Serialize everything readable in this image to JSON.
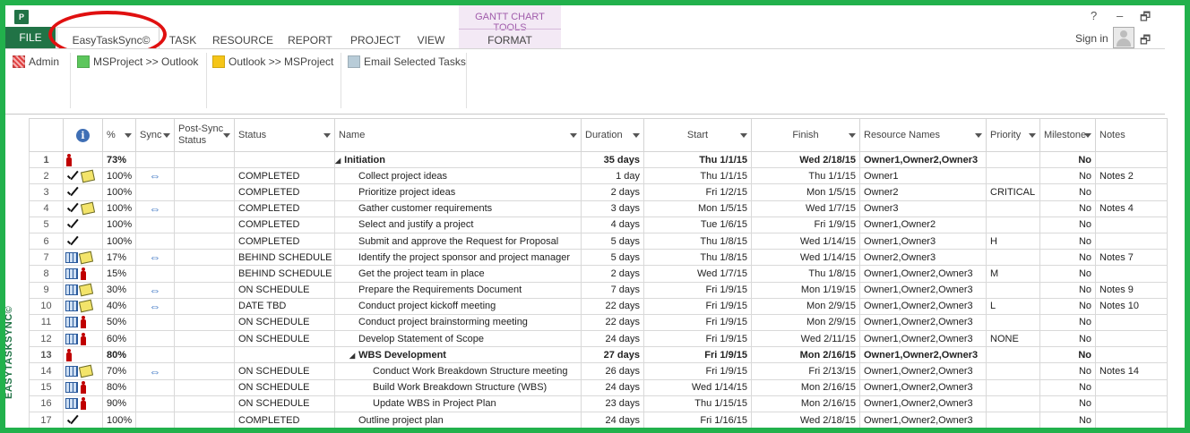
{
  "app": {
    "icon": "P",
    "icon_name": "ms-project-icon"
  },
  "tabs": {
    "file": "FILE",
    "easytasksync": "EasyTaskSync©",
    "task": "TASK",
    "resource": "RESOURCE",
    "report": "REPORT",
    "project": "PROJECT",
    "view": "VIEW",
    "context_group": "GANTT CHART TOOLS",
    "format": "FORMAT"
  },
  "window": {
    "help": "?",
    "minimize": "–",
    "restore": "🗗",
    "restore2": "🗗",
    "signin": "Sign in"
  },
  "ribbon": {
    "admin": "Admin",
    "ms_to_outlook": "MSProject >> Outlook",
    "outlook_to_ms": "Outlook >> MSProject",
    "email_tasks": "Email Selected Tasks"
  },
  "colors": {
    "file_tab": "#217346",
    "frame": "#22b14c",
    "highlight_ellipse": "#e01010",
    "context": "#a05cab",
    "admin": "#e04040",
    "ms_to_outlook": "#5cc65c",
    "outlook_to_ms": "#f5c518",
    "email": "#b8ccd8"
  },
  "side_label": "EASYTASKSYNC©",
  "columns": {
    "pct": "%",
    "sync": "Sync",
    "post_sync_status": "Post-Sync Status",
    "status": "Status",
    "name": "Name",
    "duration": "Duration",
    "start": "Start",
    "finish": "Finish",
    "resource_names": "Resource Names",
    "priority": "Priority",
    "milestone": "Milestone",
    "notes": "Notes"
  },
  "rows": [
    {
      "id": "1",
      "icons": [
        "person"
      ],
      "pct": "73%",
      "sync": false,
      "status": "",
      "name": "Initiation",
      "level": 0,
      "summary": true,
      "duration": "35 days",
      "start": "Thu 1/1/15",
      "finish": "Wed 2/18/15",
      "resources": "Owner1,Owner2,Owner3",
      "priority": "",
      "milestone": "No",
      "notes": ""
    },
    {
      "id": "2",
      "icons": [
        "check",
        "note"
      ],
      "pct": "100%",
      "sync": true,
      "status": "COMPLETED",
      "name": "Collect project ideas",
      "level": 1,
      "summary": false,
      "duration": "1 day",
      "start": "Thu 1/1/15",
      "finish": "Thu 1/1/15",
      "resources": "Owner1",
      "priority": "",
      "milestone": "No",
      "notes": "Notes 2"
    },
    {
      "id": "3",
      "icons": [
        "check"
      ],
      "pct": "100%",
      "sync": false,
      "status": "COMPLETED",
      "name": "Prioritize project ideas",
      "level": 1,
      "summary": false,
      "duration": "2 days",
      "start": "Fri 1/2/15",
      "finish": "Mon 1/5/15",
      "resources": "Owner2",
      "priority": "CRITICAL",
      "milestone": "No",
      "notes": ""
    },
    {
      "id": "4",
      "icons": [
        "check",
        "note"
      ],
      "pct": "100%",
      "sync": true,
      "status": "COMPLETED",
      "name": "Gather customer requirements",
      "level": 1,
      "summary": false,
      "duration": "3 days",
      "start": "Mon 1/5/15",
      "finish": "Wed 1/7/15",
      "resources": "Owner3",
      "priority": "",
      "milestone": "No",
      "notes": "Notes 4"
    },
    {
      "id": "5",
      "icons": [
        "check"
      ],
      "pct": "100%",
      "sync": false,
      "status": "COMPLETED",
      "name": "Select and justify a project",
      "level": 1,
      "summary": false,
      "duration": "4 days",
      "start": "Tue 1/6/15",
      "finish": "Fri 1/9/15",
      "resources": "Owner1,Owner2",
      "priority": "",
      "milestone": "No",
      "notes": ""
    },
    {
      "id": "6",
      "icons": [
        "check"
      ],
      "pct": "100%",
      "sync": false,
      "status": "COMPLETED",
      "name": "Submit and approve the Request for Proposal",
      "level": 1,
      "summary": false,
      "duration": "5 days",
      "start": "Thu 1/8/15",
      "finish": "Wed 1/14/15",
      "resources": "Owner1,Owner3",
      "priority": "H",
      "milestone": "No",
      "notes": ""
    },
    {
      "id": "7",
      "icons": [
        "table",
        "note"
      ],
      "pct": "17%",
      "sync": true,
      "status": "BEHIND SCHEDULE",
      "name": "Identify the project sponsor and project manager",
      "level": 1,
      "summary": false,
      "duration": "5 days",
      "start": "Thu 1/8/15",
      "finish": "Wed 1/14/15",
      "resources": "Owner2,Owner3",
      "priority": "",
      "milestone": "No",
      "notes": "Notes 7"
    },
    {
      "id": "8",
      "icons": [
        "table",
        "person"
      ],
      "pct": "15%",
      "sync": false,
      "status": "BEHIND SCHEDULE",
      "name": "Get the project team in place",
      "level": 1,
      "summary": false,
      "duration": "2 days",
      "start": "Wed 1/7/15",
      "finish": "Thu 1/8/15",
      "resources": "Owner1,Owner2,Owner3",
      "priority": "M",
      "milestone": "No",
      "notes": ""
    },
    {
      "id": "9",
      "icons": [
        "table",
        "note"
      ],
      "pct": "30%",
      "sync": true,
      "status": "ON SCHEDULE",
      "name": "Prepare the Requirements Document",
      "level": 1,
      "summary": false,
      "duration": "7 days",
      "start": "Fri 1/9/15",
      "finish": "Mon 1/19/15",
      "resources": "Owner1,Owner2,Owner3",
      "priority": "",
      "milestone": "No",
      "notes": "Notes 9"
    },
    {
      "id": "10",
      "icons": [
        "table",
        "note"
      ],
      "pct": "40%",
      "sync": true,
      "status": "DATE TBD",
      "name": "Conduct project kickoff meeting",
      "level": 1,
      "summary": false,
      "duration": "22 days",
      "start": "Fri 1/9/15",
      "finish": "Mon 2/9/15",
      "resources": "Owner1,Owner2,Owner3",
      "priority": "L",
      "milestone": "No",
      "notes": "Notes 10"
    },
    {
      "id": "11",
      "icons": [
        "table",
        "person"
      ],
      "pct": "50%",
      "sync": false,
      "status": "ON SCHEDULE",
      "name": "Conduct project brainstorming meeting",
      "level": 1,
      "summary": false,
      "duration": "22 days",
      "start": "Fri 1/9/15",
      "finish": "Mon 2/9/15",
      "resources": "Owner1,Owner2,Owner3",
      "priority": "",
      "milestone": "No",
      "notes": ""
    },
    {
      "id": "12",
      "icons": [
        "table",
        "person"
      ],
      "pct": "60%",
      "sync": false,
      "status": "ON SCHEDULE",
      "name": "Develop Statement of Scope",
      "level": 1,
      "summary": false,
      "duration": "24 days",
      "start": "Fri 1/9/15",
      "finish": "Wed 2/11/15",
      "resources": "Owner1,Owner2,Owner3",
      "priority": "NONE",
      "milestone": "No",
      "notes": ""
    },
    {
      "id": "13",
      "icons": [
        "person"
      ],
      "pct": "80%",
      "sync": false,
      "status": "",
      "name": "WBS Development",
      "level": 1,
      "summary": true,
      "duration": "27 days",
      "start": "Fri 1/9/15",
      "finish": "Mon 2/16/15",
      "resources": "Owner1,Owner2,Owner3",
      "priority": "",
      "milestone": "No",
      "notes": ""
    },
    {
      "id": "14",
      "icons": [
        "table",
        "note"
      ],
      "pct": "70%",
      "sync": true,
      "status": "ON SCHEDULE",
      "name": "Conduct Work Breakdown Structure meeting",
      "level": 2,
      "summary": false,
      "duration": "26 days",
      "start": "Fri 1/9/15",
      "finish": "Fri 2/13/15",
      "resources": "Owner1,Owner2,Owner3",
      "priority": "",
      "milestone": "No",
      "notes": "Notes 14"
    },
    {
      "id": "15",
      "icons": [
        "table",
        "person"
      ],
      "pct": "80%",
      "sync": false,
      "status": "ON SCHEDULE",
      "name": "Build Work Breakdown Structure (WBS)",
      "level": 2,
      "summary": false,
      "duration": "24 days",
      "start": "Wed 1/14/15",
      "finish": "Mon 2/16/15",
      "resources": "Owner1,Owner2,Owner3",
      "priority": "",
      "milestone": "No",
      "notes": ""
    },
    {
      "id": "16",
      "icons": [
        "table",
        "person"
      ],
      "pct": "90%",
      "sync": false,
      "status": "ON SCHEDULE",
      "name": "Update WBS in Project Plan",
      "level": 2,
      "summary": false,
      "duration": "23 days",
      "start": "Thu 1/15/15",
      "finish": "Mon 2/16/15",
      "resources": "Owner1,Owner2,Owner3",
      "priority": "",
      "milestone": "No",
      "notes": ""
    },
    {
      "id": "17",
      "icons": [
        "check"
      ],
      "pct": "100%",
      "sync": false,
      "status": "COMPLETED",
      "name": "Outline project plan",
      "level": 1,
      "summary": false,
      "duration": "24 days",
      "start": "Fri 1/16/15",
      "finish": "Wed 2/18/15",
      "resources": "Owner1,Owner2,Owner3",
      "priority": "",
      "milestone": "No",
      "notes": ""
    }
  ]
}
